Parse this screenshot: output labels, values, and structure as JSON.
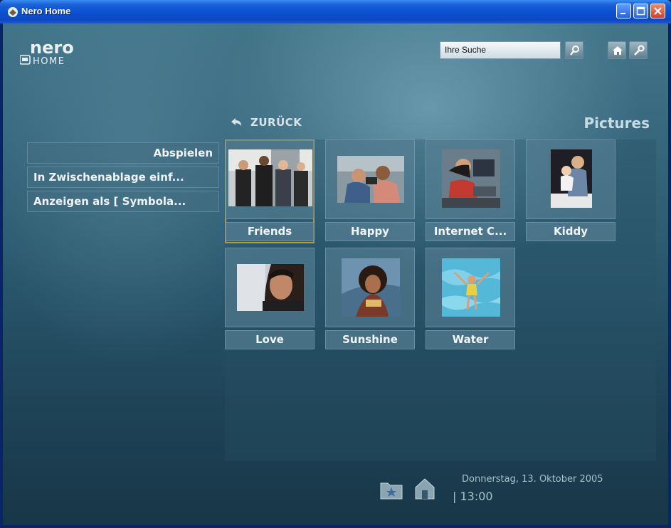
{
  "window": {
    "title": "Nero Home",
    "controls": [
      "minimize",
      "maximize",
      "close"
    ]
  },
  "header": {
    "logo_top": "nero",
    "logo_bottom": "HOME",
    "search_placeholder": "Ihre Suche",
    "buttons": [
      "search-icon",
      "home-icon",
      "wrench-icon"
    ]
  },
  "nav": {
    "back_label": "ZURÜCK",
    "section_title": "Pictures"
  },
  "menu": {
    "items": [
      {
        "label": "Abspielen"
      },
      {
        "label": "In Zwischenablage einf..."
      },
      {
        "label": "Anzeigen als [ Symbola..."
      }
    ]
  },
  "albums": [
    {
      "label": "Friends",
      "selected": true
    },
    {
      "label": "Happy",
      "selected": false
    },
    {
      "label": "Internet C...",
      "selected": false
    },
    {
      "label": "Kiddy",
      "selected": false
    },
    {
      "label": "Love",
      "selected": false
    },
    {
      "label": "Sunshine",
      "selected": false
    },
    {
      "label": "Water",
      "selected": false
    }
  ],
  "footer": {
    "date": "Donnerstag, 13. Oktober 2005",
    "time": "| 13:00",
    "icons": [
      "favorites-folder-icon",
      "home-icon"
    ]
  },
  "colors": {
    "selection_border": "#b89a3a",
    "titlebar": "#0a4fd0"
  }
}
